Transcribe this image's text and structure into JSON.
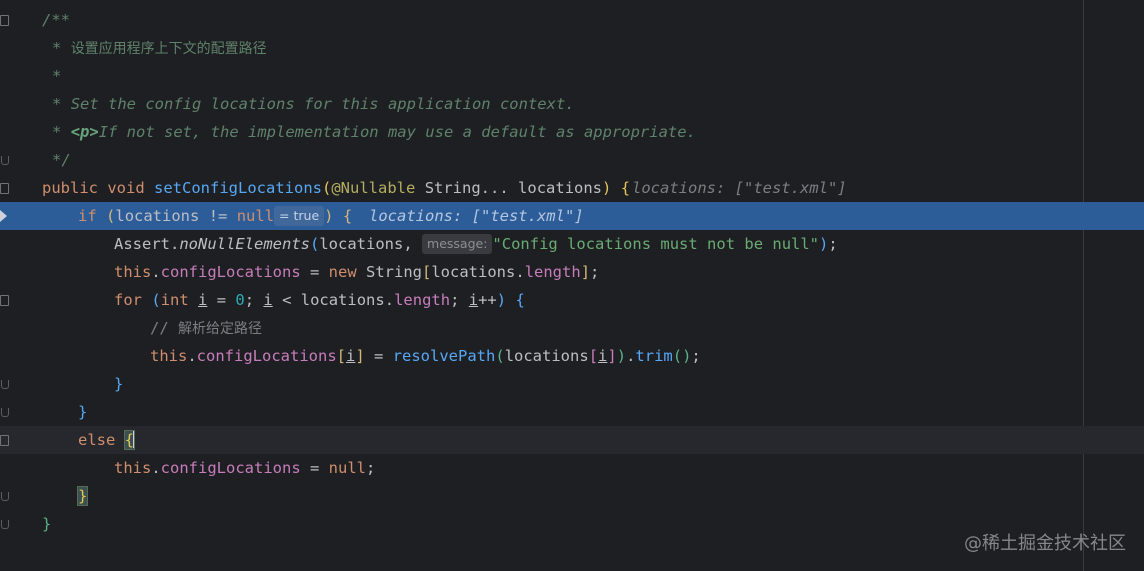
{
  "code": {
    "doc_open": "/**",
    "doc_star": "*",
    "doc_cn": "设置应用程序上下文的配置路径",
    "doc_en1": "Set the config locations for this application context.",
    "doc_p_tag": "<p>",
    "doc_en2": "If not set, the implementation may use a default as appropriate.",
    "doc_close": "*/",
    "kw_public": "public",
    "kw_void": "void",
    "method_name": "setConfigLocations",
    "annotation": "@Nullable",
    "param_type": "String...",
    "param_name": "locations",
    "kw_if": "if",
    "var_locations": "locations",
    "op_neq": "!=",
    "kw_null": "null",
    "inline_eval": "= true",
    "inlay_value": "locations: [\"test.xml\"]",
    "assert_class": "Assert",
    "assert_method": "noNullElements",
    "hint_message": "message:",
    "message_string": "\"Config locations must not be null\"",
    "kw_this": "this",
    "field_config": "configLocations",
    "kw_new": "new",
    "type_string": "String",
    "field_length": "length",
    "kw_for": "for",
    "kw_int": "int",
    "var_i": "i",
    "num_zero": "0",
    "comment_slash": "//",
    "comment_text": "解析给定路径",
    "method_resolve": "resolvePath",
    "method_trim": "trim",
    "kw_else": "else"
  },
  "watermark": "@稀土掘金技术社区",
  "colors": {
    "background": "#1e1f22",
    "execution_line": "#2d5d99",
    "keyword": "#cf8e6d",
    "method": "#56a8f5",
    "field": "#c77dbb",
    "string": "#6aab73",
    "doc_comment": "#5f826b"
  }
}
